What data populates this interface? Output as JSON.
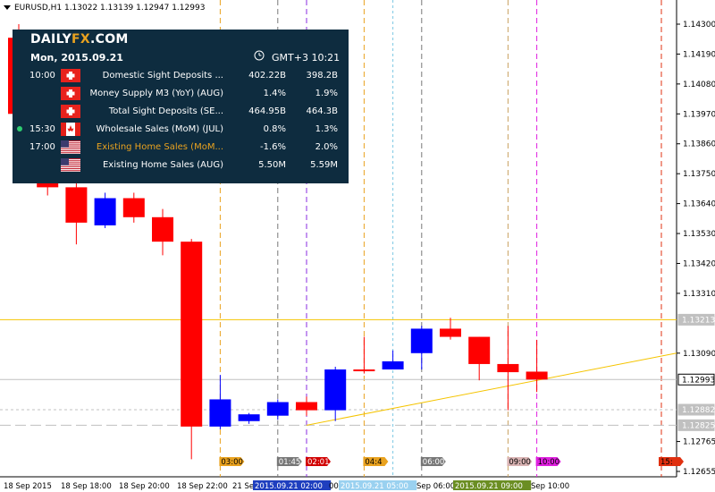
{
  "chart_title": "EURUSD,H1  1.13022 1.13139 1.12947 1.12993",
  "calendar": {
    "logo_main": "DAILY",
    "logo_fx": "FX",
    "logo_tail": ".COM",
    "date": "Mon, 2015.09.21",
    "timezone": "GMT+3 10:21",
    "rows": [
      {
        "time": "10:00",
        "flag": "swiss-flag",
        "name": "Domestic Sight Deposits ...",
        "prev": "402.22B",
        "fcst": "398.2B",
        "highlight": false,
        "dot": false
      },
      {
        "time": "",
        "flag": "swiss-flag",
        "name": "Money Supply M3 (YoY) (AUG)",
        "prev": "1.4%",
        "fcst": "1.9%",
        "highlight": false,
        "dot": false
      },
      {
        "time": "",
        "flag": "swiss-flag",
        "name": "Total Sight Deposits (SE...",
        "prev": "464.95B",
        "fcst": "464.3B",
        "highlight": false,
        "dot": false
      },
      {
        "time": "15:30",
        "flag": "canada-flag",
        "name": "Wholesale Sales (MoM) (JUL)",
        "prev": "0.8%",
        "fcst": "1.3%",
        "highlight": false,
        "dot": true
      },
      {
        "time": "17:00",
        "flag": "us-flag",
        "name": "Existing Home Sales (MoM...",
        "prev": "-1.6%",
        "fcst": "2.0%",
        "highlight": true,
        "dot": false
      },
      {
        "time": "",
        "flag": "us-flag",
        "name": "Existing Home Sales (AUG)",
        "prev": "5.50M",
        "fcst": "5.59M",
        "highlight": false,
        "dot": false
      }
    ]
  },
  "chart_data": {
    "type": "candlestick",
    "price_ticks": [
      "1.14300",
      "1.14190",
      "1.14080",
      "1.13970",
      "1.13860",
      "1.13750",
      "1.13640",
      "1.13530",
      "1.13420",
      "1.13310",
      "1.13090",
      "1.12765",
      "1.12655"
    ],
    "ylim": [
      1.12655,
      1.143
    ],
    "price_labels": [
      {
        "text": "1.13213",
        "price": 1.13213,
        "style": "gray"
      },
      {
        "text": "1.12993",
        "price": 1.12993,
        "style": "current"
      },
      {
        "text": "1.12882",
        "price": 1.12882,
        "style": "gray"
      },
      {
        "text": "1.12825",
        "price": 1.12825,
        "style": "gray"
      }
    ],
    "time_labels": [
      "18 Sep 2015",
      "18 Sep 18:00",
      "18 Sep 20:00",
      "18 Sep 22:00",
      "21 Se",
      "2015.09.21 02:00",
      "00",
      "2015.09.21 05:00",
      "Sep 06:00",
      "2015.09.21 09:00",
      "Sep 10:00"
    ],
    "candles": [
      {
        "open": 1.1425,
        "close": 1.1397,
        "high": 1.143,
        "low": 1.1392
      },
      {
        "open": 1.1376,
        "close": 1.137,
        "high": 1.1386,
        "low": 1.1367
      },
      {
        "open": 1.137,
        "close": 1.1357,
        "high": 1.1372,
        "low": 1.1349
      },
      {
        "open": 1.1356,
        "close": 1.1366,
        "high": 1.1368,
        "low": 1.1355
      },
      {
        "open": 1.1366,
        "close": 1.1359,
        "high": 1.1368,
        "low": 1.1357
      },
      {
        "open": 1.1359,
        "close": 1.135,
        "high": 1.1362,
        "low": 1.1345
      },
      {
        "open": 1.135,
        "close": 1.1282,
        "high": 1.1351,
        "low": 1.127
      },
      {
        "open": 1.1282,
        "close": 1.1292,
        "high": 1.1301,
        "low": 1.1281
      },
      {
        "open": 1.1284,
        "close": 1.12865,
        "high": 1.1287,
        "low": 1.1283
      },
      {
        "open": 1.1286,
        "close": 1.1291,
        "high": 1.1292,
        "low": 1.12845
      },
      {
        "open": 1.1291,
        "close": 1.1288,
        "high": 1.1293,
        "low": 1.1286
      },
      {
        "open": 1.1288,
        "close": 1.1303,
        "high": 1.1304,
        "low": 1.1284
      },
      {
        "open": 1.1303,
        "close": 1.13025,
        "high": 1.1315,
        "low": 1.13015
      },
      {
        "open": 1.1303,
        "close": 1.1306,
        "high": 1.131,
        "low": 1.1303
      },
      {
        "open": 1.1309,
        "close": 1.1318,
        "high": 1.1319,
        "low": 1.1303
      },
      {
        "open": 1.1318,
        "close": 1.1315,
        "high": 1.1322,
        "low": 1.1314
      },
      {
        "open": 1.1315,
        "close": 1.1305,
        "high": 1.1315,
        "low": 1.1299
      },
      {
        "open": 1.1305,
        "close": 1.1302,
        "high": 1.1319,
        "low": 1.1288
      },
      {
        "open": 1.13022,
        "close": 1.12993,
        "high": 1.13139,
        "low": 1.12947
      }
    ],
    "event_markers": [
      {
        "label": "03:00",
        "color": "#e9a21f",
        "text_color": "#000000"
      },
      {
        "label": "01:45",
        "color": "#777777",
        "text_color": "#ffffff"
      },
      {
        "label": "02:01",
        "color": "#d10000",
        "text_color": "#ffffff"
      },
      {
        "label": "04:4",
        "color": "#e9a21f",
        "text_color": "#000000"
      },
      {
        "label": "06:00",
        "color": "#777777",
        "text_color": "#ffffff"
      },
      {
        "label": "09:00",
        "color": "#d9b3b3",
        "text_color": "#000000"
      },
      {
        "label": "10:00",
        "color": "#e020e0",
        "text_color": "#000000"
      },
      {
        "label": "15:",
        "color": "#e03010",
        "text_color": "#000000"
      }
    ],
    "colors": {
      "bull": "#0000ff",
      "bear": "#ff0000",
      "trend": "#f5c400",
      "grid": "#c0c0c0"
    }
  }
}
